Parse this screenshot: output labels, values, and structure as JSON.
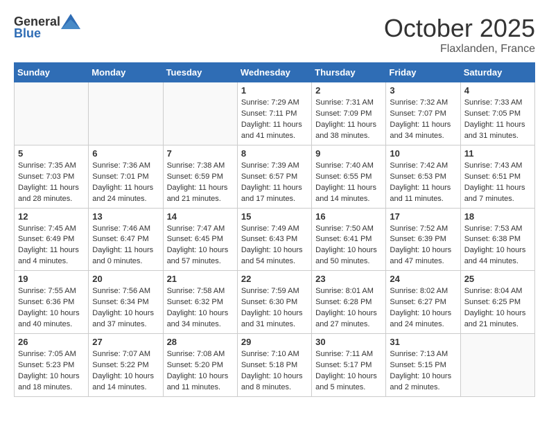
{
  "header": {
    "logo_general": "General",
    "logo_blue": "Blue",
    "month": "October 2025",
    "location": "Flaxlanden, France"
  },
  "weekdays": [
    "Sunday",
    "Monday",
    "Tuesday",
    "Wednesday",
    "Thursday",
    "Friday",
    "Saturday"
  ],
  "weeks": [
    [
      {
        "day": "",
        "info": ""
      },
      {
        "day": "",
        "info": ""
      },
      {
        "day": "",
        "info": ""
      },
      {
        "day": "1",
        "info": "Sunrise: 7:29 AM\nSunset: 7:11 PM\nDaylight: 11 hours and 41 minutes."
      },
      {
        "day": "2",
        "info": "Sunrise: 7:31 AM\nSunset: 7:09 PM\nDaylight: 11 hours and 38 minutes."
      },
      {
        "day": "3",
        "info": "Sunrise: 7:32 AM\nSunset: 7:07 PM\nDaylight: 11 hours and 34 minutes."
      },
      {
        "day": "4",
        "info": "Sunrise: 7:33 AM\nSunset: 7:05 PM\nDaylight: 11 hours and 31 minutes."
      }
    ],
    [
      {
        "day": "5",
        "info": "Sunrise: 7:35 AM\nSunset: 7:03 PM\nDaylight: 11 hours and 28 minutes."
      },
      {
        "day": "6",
        "info": "Sunrise: 7:36 AM\nSunset: 7:01 PM\nDaylight: 11 hours and 24 minutes."
      },
      {
        "day": "7",
        "info": "Sunrise: 7:38 AM\nSunset: 6:59 PM\nDaylight: 11 hours and 21 minutes."
      },
      {
        "day": "8",
        "info": "Sunrise: 7:39 AM\nSunset: 6:57 PM\nDaylight: 11 hours and 17 minutes."
      },
      {
        "day": "9",
        "info": "Sunrise: 7:40 AM\nSunset: 6:55 PM\nDaylight: 11 hours and 14 minutes."
      },
      {
        "day": "10",
        "info": "Sunrise: 7:42 AM\nSunset: 6:53 PM\nDaylight: 11 hours and 11 minutes."
      },
      {
        "day": "11",
        "info": "Sunrise: 7:43 AM\nSunset: 6:51 PM\nDaylight: 11 hours and 7 minutes."
      }
    ],
    [
      {
        "day": "12",
        "info": "Sunrise: 7:45 AM\nSunset: 6:49 PM\nDaylight: 11 hours and 4 minutes."
      },
      {
        "day": "13",
        "info": "Sunrise: 7:46 AM\nSunset: 6:47 PM\nDaylight: 11 hours and 0 minutes."
      },
      {
        "day": "14",
        "info": "Sunrise: 7:47 AM\nSunset: 6:45 PM\nDaylight: 10 hours and 57 minutes."
      },
      {
        "day": "15",
        "info": "Sunrise: 7:49 AM\nSunset: 6:43 PM\nDaylight: 10 hours and 54 minutes."
      },
      {
        "day": "16",
        "info": "Sunrise: 7:50 AM\nSunset: 6:41 PM\nDaylight: 10 hours and 50 minutes."
      },
      {
        "day": "17",
        "info": "Sunrise: 7:52 AM\nSunset: 6:39 PM\nDaylight: 10 hours and 47 minutes."
      },
      {
        "day": "18",
        "info": "Sunrise: 7:53 AM\nSunset: 6:38 PM\nDaylight: 10 hours and 44 minutes."
      }
    ],
    [
      {
        "day": "19",
        "info": "Sunrise: 7:55 AM\nSunset: 6:36 PM\nDaylight: 10 hours and 40 minutes."
      },
      {
        "day": "20",
        "info": "Sunrise: 7:56 AM\nSunset: 6:34 PM\nDaylight: 10 hours and 37 minutes."
      },
      {
        "day": "21",
        "info": "Sunrise: 7:58 AM\nSunset: 6:32 PM\nDaylight: 10 hours and 34 minutes."
      },
      {
        "day": "22",
        "info": "Sunrise: 7:59 AM\nSunset: 6:30 PM\nDaylight: 10 hours and 31 minutes."
      },
      {
        "day": "23",
        "info": "Sunrise: 8:01 AM\nSunset: 6:28 PM\nDaylight: 10 hours and 27 minutes."
      },
      {
        "day": "24",
        "info": "Sunrise: 8:02 AM\nSunset: 6:27 PM\nDaylight: 10 hours and 24 minutes."
      },
      {
        "day": "25",
        "info": "Sunrise: 8:04 AM\nSunset: 6:25 PM\nDaylight: 10 hours and 21 minutes."
      }
    ],
    [
      {
        "day": "26",
        "info": "Sunrise: 7:05 AM\nSunset: 5:23 PM\nDaylight: 10 hours and 18 minutes."
      },
      {
        "day": "27",
        "info": "Sunrise: 7:07 AM\nSunset: 5:22 PM\nDaylight: 10 hours and 14 minutes."
      },
      {
        "day": "28",
        "info": "Sunrise: 7:08 AM\nSunset: 5:20 PM\nDaylight: 10 hours and 11 minutes."
      },
      {
        "day": "29",
        "info": "Sunrise: 7:10 AM\nSunset: 5:18 PM\nDaylight: 10 hours and 8 minutes."
      },
      {
        "day": "30",
        "info": "Sunrise: 7:11 AM\nSunset: 5:17 PM\nDaylight: 10 hours and 5 minutes."
      },
      {
        "day": "31",
        "info": "Sunrise: 7:13 AM\nSunset: 5:15 PM\nDaylight: 10 hours and 2 minutes."
      },
      {
        "day": "",
        "info": ""
      }
    ]
  ]
}
